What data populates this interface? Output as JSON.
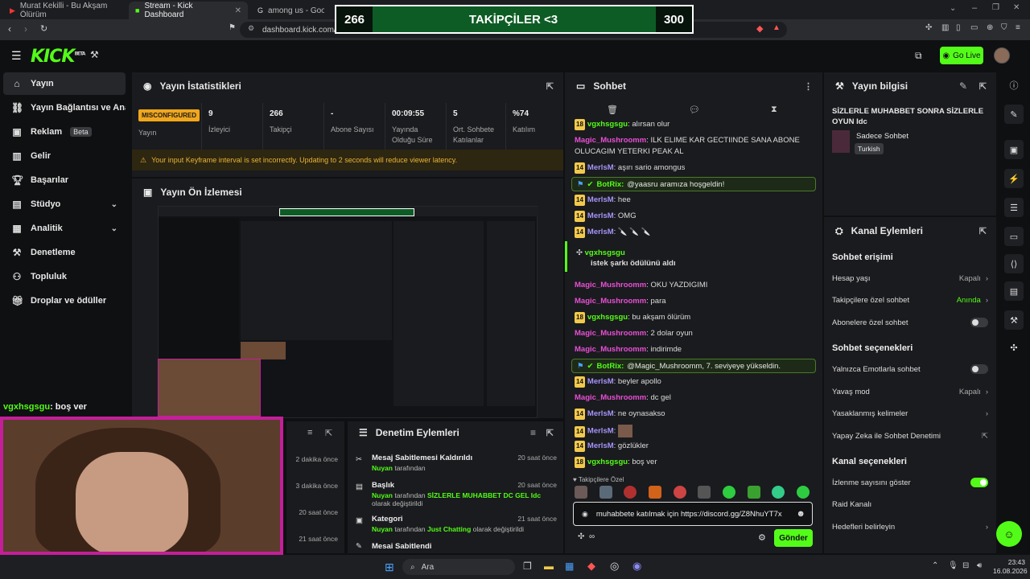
{
  "browser": {
    "tabs": [
      {
        "label": "Murat Kekilli - Bu Akşam Ölürüm"
      },
      {
        "label": "Stream - Kick Dashboard"
      },
      {
        "label": "among us - Google'da Ara"
      }
    ],
    "url": "dashboard.kick.com/stream"
  },
  "overlay": {
    "left": "266",
    "title": "TAKİPÇİLER <3",
    "right": "300"
  },
  "topnav": {
    "logo": "KICK",
    "logo_sup": "BETA",
    "go_live": "Go Live"
  },
  "sidebar": {
    "items": [
      {
        "label": "Yayın"
      },
      {
        "label": "Yayın Bağlantısı ve Anahtarı"
      },
      {
        "label": "Reklam",
        "badge": "Beta"
      },
      {
        "label": "Gelir"
      },
      {
        "label": "Başarılar"
      },
      {
        "label": "Stüdyo"
      },
      {
        "label": "Analitik"
      },
      {
        "label": "Denetleme"
      },
      {
        "label": "Topluluk"
      },
      {
        "label": "Droplar ve ödüller"
      }
    ]
  },
  "stats": {
    "title": "Yayın İstatistikleri",
    "status_badge": "MISCONFIGURED",
    "status_label": "Yayın",
    "items": [
      {
        "value": "9",
        "label": "İzleyici"
      },
      {
        "value": "266",
        "label": "Takipçi"
      },
      {
        "value": "-",
        "label": "Abone Sayısı"
      },
      {
        "value": "00:09:55",
        "label": "Yayında Olduğu Süre"
      },
      {
        "value": "5",
        "label": "Ort. Sohbete Katılanlar"
      },
      {
        "value": "%74",
        "label": "Katılım"
      }
    ],
    "warning": "Your input Keyframe interval is set incorrectly. Updating to 2 seconds will reduce viewer latency."
  },
  "preview": {
    "title": "Yayın Ön İzlemesi"
  },
  "camera_chat": {
    "user": "vgxhsgsgu",
    "text": ": boş ver"
  },
  "leftlog": {
    "times": [
      "2 dakika önce",
      "3 dakika önce",
      "20 saat önce",
      "21 saat önce"
    ]
  },
  "audit": {
    "title": "Denetim Eylemleri",
    "items": [
      {
        "title": "Mesaj Sabitlemesi Kaldırıldı",
        "who": "Nuyan",
        "mid": " tarafından",
        "time": "20 saat önce"
      },
      {
        "title": "Başlık",
        "who": "Nuyan",
        "mid": " tarafından ",
        "value": "SİZLERLE MUHABBET DC GEL Idc",
        "tail": " olarak değiştirildi",
        "time": "20 saat önce"
      },
      {
        "title": "Kategori",
        "who": "Nuyan",
        "mid": " tarafından ",
        "value": "Just Chatting",
        "tail": " olarak değiştirildi",
        "time": "21 saat önce"
      },
      {
        "title": "Mesai Sabitlendi",
        "time": ""
      }
    ]
  },
  "chat": {
    "title": "Sohbet",
    "messages": [
      {
        "badge": "18",
        "user": "vgxhsgsgu",
        "color": "#53fc18",
        "text": " alırsan olur"
      },
      {
        "badge": "",
        "user": "Magic_Mushroomm",
        "color": "#e84fd6",
        "text": " ILK ELIME KAR GECTIINDE SANA ABONE OLUCAGIM YETERKI PEAK AL"
      },
      {
        "badge": "14",
        "user": "MerlsM",
        "color": "#a594f9",
        "text": " aşırı sario amongus"
      },
      {
        "badge": "14",
        "user": "MerlsM",
        "color": "#a594f9",
        "text": " hee"
      },
      {
        "badge": "14",
        "user": "MerlsM",
        "color": "#a594f9",
        "text": " OMG"
      },
      {
        "badge": "14",
        "user": "MerlsM",
        "color": "#a594f9",
        "text": " 🔪 🔪 🔪"
      },
      {
        "badge": "",
        "user": "Magic_Mushroomm",
        "color": "#e84fd6",
        "text": " OKU YAZDIGIMI"
      },
      {
        "badge": "",
        "user": "Magic_Mushroomm",
        "color": "#e84fd6",
        "text": " para"
      },
      {
        "badge": "18",
        "user": "vgxhsgsgu",
        "color": "#53fc18",
        "text": " bu akşam ölürüm"
      },
      {
        "badge": "",
        "user": "Magic_Mushroomm",
        "color": "#e84fd6",
        "text": " 2 dolar oyun"
      },
      {
        "badge": "",
        "user": "Magic_Mushroomm",
        "color": "#e84fd6",
        "text": " indirimde"
      },
      {
        "badge": "14",
        "user": "MerlsM",
        "color": "#a594f9",
        "text": " beyler apollo"
      },
      {
        "badge": "",
        "user": "Magic_Mushroomm",
        "color": "#e84fd6",
        "text": " dc gel"
      },
      {
        "badge": "14",
        "user": "MerlsM",
        "color": "#a594f9",
        "text": " ne oynasakso"
      },
      {
        "badge": "14",
        "user": "MerlsM",
        "color": "#a594f9",
        "text": " "
      },
      {
        "badge": "14",
        "user": "MerlsM",
        "color": "#a594f9",
        "text": " gözlükler"
      },
      {
        "badge": "18",
        "user": "vgxhsgsgu",
        "color": "#53fc18",
        "text": " boş ver"
      }
    ],
    "bot1": {
      "user": "BotRix:",
      "text": " @yaasru aramıza hoşgeldin!"
    },
    "bot2": {
      "user": "BotRix:",
      "text": " @Magic_Mushroomm, 7. seviyeye yükseldin."
    },
    "redeem": {
      "user": "vgxhsgsgu",
      "text": "istek şarkı ödülünü aldı"
    },
    "followers_only": "Takipçilere Özel",
    "input_value": "muhabbete katılmak için https://discord.gg/Z8NhuYT7x",
    "send": "Gönder"
  },
  "info": {
    "title": "Yayın bilgisi",
    "stream_title": "SİZLERLE MUHABBET SONRA SİZLERLE OYUN Idc",
    "category": "Sadece Sohbet",
    "language": "Turkish"
  },
  "channel": {
    "title": "Kanal Eylemleri",
    "chat_access": "Sohbet erişimi",
    "age": {
      "label": "Hesap yaşı",
      "value": "Kapalı"
    },
    "follower_only": {
      "label": "Takipçilere özel sohbet",
      "value": "Anında"
    },
    "sub_only": {
      "label": "Abonelere özel sohbet"
    },
    "chat_options": "Sohbet seçenekleri",
    "emote_only": {
      "label": "Yalnızca Emotlarla sohbet"
    },
    "slow": {
      "label": "Yavaş mod",
      "value": "Kapalı"
    },
    "banned": {
      "label": "Yasaklanmış kelimeler"
    },
    "ai": {
      "label": "Yapay Zeka ile Sohbet Denetimi"
    },
    "channel_options": "Kanal seçenekleri",
    "viewer_count": {
      "label": "İzlenme sayısını göster"
    },
    "raid": {
      "label": "Raid Kanalı"
    },
    "goals": {
      "label": "Hedefleri belirleyin"
    }
  },
  "taskbar": {
    "search": "Ara",
    "time": "23:43",
    "date": "16.08.2026"
  },
  "colors": {
    "accent": "#53fc18",
    "bg": "#0f1012",
    "panel": "#1a1b1e",
    "stream_border": "#c41f9a",
    "overlay_bg": "#0e5c25"
  }
}
